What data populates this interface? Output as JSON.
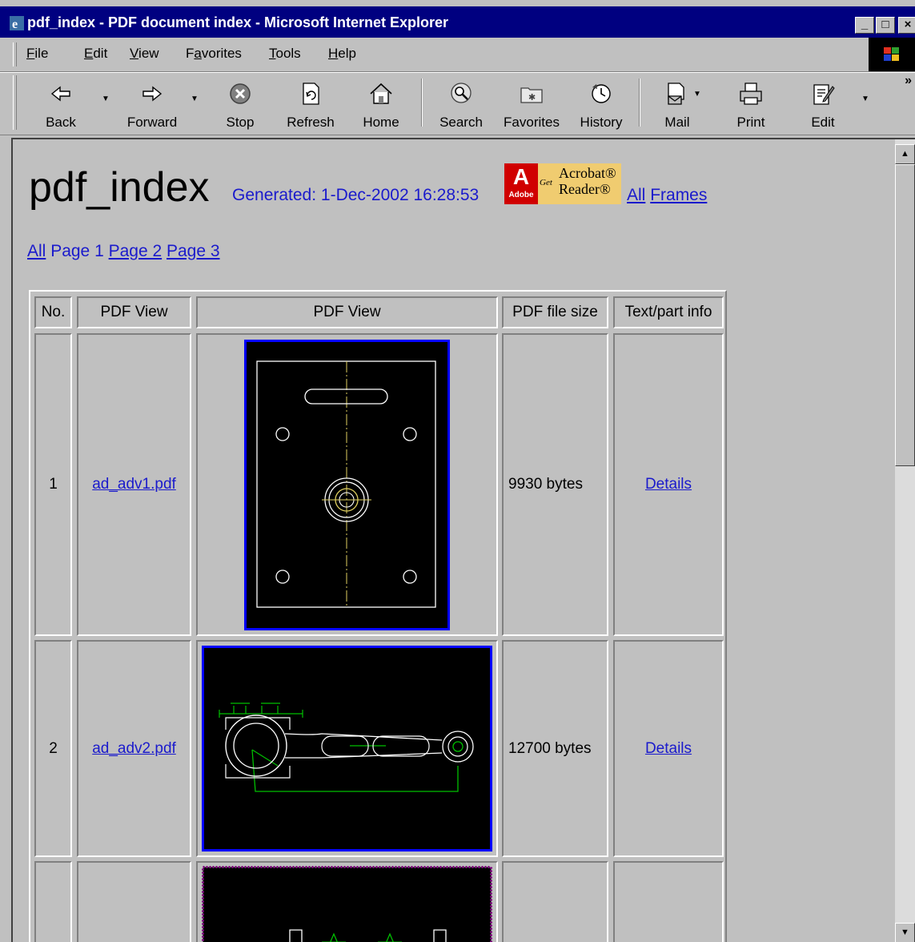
{
  "window": {
    "title": "pdf_index - PDF document index - Microsoft Internet Explorer",
    "controls": [
      "_",
      "□",
      "×"
    ]
  },
  "menu": {
    "items": [
      {
        "label": "File",
        "accel": "F",
        "rest": "ile"
      },
      {
        "label": "Edit",
        "accel": "E",
        "rest": "dit"
      },
      {
        "label": "View",
        "accel": "V",
        "rest": "iew"
      },
      {
        "label": "Favorites",
        "prefix": "F",
        "accel": "a",
        "rest": "vorites"
      },
      {
        "label": "Tools",
        "accel": "T",
        "rest": "ools"
      },
      {
        "label": "Help",
        "accel": "H",
        "rest": "elp"
      }
    ]
  },
  "toolbar": {
    "buttons": [
      {
        "label": "Back",
        "icon": "back-arrow-icon"
      },
      {
        "label": "Forward",
        "icon": "forward-arrow-icon"
      },
      {
        "label": "Stop",
        "icon": "stop-icon"
      },
      {
        "label": "Refresh",
        "icon": "refresh-icon"
      },
      {
        "label": "Home",
        "icon": "home-icon"
      },
      {
        "label": "Search",
        "icon": "search-icon"
      },
      {
        "label": "Favorites",
        "icon": "favorites-folder-icon"
      },
      {
        "label": "History",
        "icon": "history-icon"
      },
      {
        "label": "Mail",
        "icon": "mail-icon"
      },
      {
        "label": "Print",
        "icon": "printer-icon"
      },
      {
        "label": "Edit",
        "icon": "edit-icon"
      }
    ],
    "more": "»"
  },
  "page": {
    "title": "pdf_index",
    "generated": "Generated: 1-Dec-2002 16:28:53",
    "acrobat_badge": {
      "adobe": "Adobe",
      "got": "Get",
      "product_line1": "Acrobat®",
      "product_line2": "Reader®"
    },
    "top_links": {
      "all": "All",
      "frames": "Frames"
    },
    "page_links": {
      "all": "All",
      "current": "Page 1",
      "page2": "Page 2",
      "page3": "Page 3"
    }
  },
  "table": {
    "headers": [
      "No.",
      "PDF View",
      "PDF View",
      "PDF file size",
      "Text/part info"
    ],
    "rows": [
      {
        "no": "1",
        "file": "ad_adv1.pdf",
        "size": "9930 bytes",
        "info": "Details"
      },
      {
        "no": "2",
        "file": "ad_adv2.pdf",
        "size": "12700 bytes",
        "info": "Details"
      }
    ]
  },
  "colors": {
    "title_bar": "#000080",
    "link": "#1a1acc",
    "thumb_border_blue": "#0000ff",
    "thumb_border_purple": "#800080",
    "drawing_white": "#ffffff",
    "drawing_green": "#00c000",
    "centerline_yellow": "#e0d060"
  }
}
